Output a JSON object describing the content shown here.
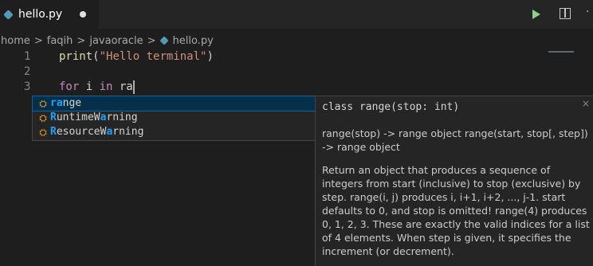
{
  "tab": {
    "file_icon": "python-file-icon",
    "label": "hello.py",
    "dirty_indicator": "unsaved-dot-icon"
  },
  "toolbar": {
    "run_icon": "play-icon",
    "split_icon": "split-editor-icon",
    "more_icon": "more-actions-icon",
    "more_label": "·"
  },
  "breadcrumb": {
    "items": [
      "home",
      "faqih",
      "javaoracle"
    ],
    "separator": ">",
    "file": "hello.py"
  },
  "editor": {
    "lines": [
      {
        "number": "1",
        "tokens": [
          {
            "text": "print",
            "kind": "fn"
          },
          {
            "text": "(",
            "kind": "plain"
          },
          {
            "text": "\"Hello terminal\"",
            "kind": "str"
          },
          {
            "text": ")",
            "kind": "plain"
          }
        ]
      },
      {
        "number": "2",
        "tokens": []
      },
      {
        "number": "3",
        "tokens": [
          {
            "text": "for",
            "kind": "kw"
          },
          {
            "text": " i ",
            "kind": "plain"
          },
          {
            "text": "in",
            "kind": "kw"
          },
          {
            "text": " ra",
            "kind": "plain"
          }
        ]
      }
    ]
  },
  "suggestions": {
    "icon": "class-icon",
    "items": [
      {
        "pre": "",
        "match": "ra",
        "post": "nge",
        "selected": true
      },
      {
        "pre": "",
        "match": "R",
        "post": "untimeW",
        "match2": "a",
        "post2": "rning",
        "selected": false
      },
      {
        "pre": "",
        "match": "R",
        "post": "esourceW",
        "match2": "a",
        "post2": "rning",
        "selected": false
      }
    ]
  },
  "details": {
    "signature": "class range(stop: int)",
    "close_label": "×",
    "summary": "range(stop) -> range object range(start, stop[, step]) -> range object",
    "doc": "Return an object that produces a sequence of integers from start (inclusive) to stop (exclusive) by step. range(i, j) produces i, i+1, i+2, ..., j-1. start defaults to 0, and stop is omitted! range(4) produces 0, 1, 2, 3. These are exactly the valid indices for a list of 4 elements. When step is given, it specifies the increment (or decrement)."
  },
  "colors": {
    "editor_bg": "#1e1e1e",
    "widget_bg": "#252526",
    "match_highlight": "#18a3ff",
    "selected_row": "#062f4a",
    "keyword": "#c586c0",
    "function": "#dcdcaa",
    "string": "#ce9178"
  }
}
